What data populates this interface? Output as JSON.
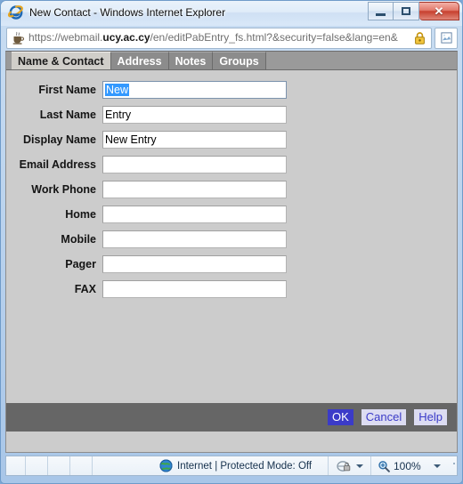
{
  "window": {
    "title": "New Contact - Windows Internet Explorer",
    "app_icon": "internet-explorer-icon",
    "controls": {
      "minimize": "minimize-button",
      "restore": "restore-button",
      "close_glyph": "✕"
    }
  },
  "address_bar": {
    "site_icon": "java-coffee-cup-icon",
    "url_scheme": "https://",
    "url_subdomain": "webmail.",
    "url_domain": "ucy.ac.cy",
    "url_path": "/en/editPabEntry_fs.html?&security=false&lang=en&",
    "lock_icon": "padlock-icon",
    "extra_button_icon": "page-report-icon"
  },
  "tabs": [
    {
      "label": "Name & Contact",
      "active": true
    },
    {
      "label": "Address",
      "active": false
    },
    {
      "label": "Notes",
      "active": false
    },
    {
      "label": "Groups",
      "active": false
    }
  ],
  "form": {
    "fields": [
      {
        "label": "First Name",
        "value": "New",
        "selected": true,
        "focused": true
      },
      {
        "label": "Last Name",
        "value": "Entry",
        "selected": false,
        "focused": false
      },
      {
        "label": "Display Name",
        "value": "New Entry",
        "selected": false,
        "focused": false
      },
      {
        "label": "Email Address",
        "value": "",
        "selected": false,
        "focused": false
      },
      {
        "label": "Work Phone",
        "value": "",
        "selected": false,
        "focused": false
      },
      {
        "label": "Home",
        "value": "",
        "selected": false,
        "focused": false
      },
      {
        "label": "Mobile",
        "value": "",
        "selected": false,
        "focused": false
      },
      {
        "label": "Pager",
        "value": "",
        "selected": false,
        "focused": false
      },
      {
        "label": "FAX",
        "value": "",
        "selected": false,
        "focused": false
      }
    ]
  },
  "buttons": {
    "ok": "OK",
    "cancel": "Cancel",
    "help": "Help"
  },
  "status_bar": {
    "zone_icon": "globe-icon",
    "zone_text": "Internet | Protected Mode: Off",
    "privacy_icon": "privacy-report-icon",
    "zoom_icon": "zoom-magnifier-icon",
    "zoom_level": "100%"
  },
  "colors": {
    "selection_blue": "#3399ff",
    "primary_button_bg": "#3b3bc8",
    "button_bar_bg": "#666666",
    "page_bg": "#cccccc",
    "tab_inactive_bg": "#8c8c8c",
    "tab_active_bg": "#d0cec9"
  }
}
